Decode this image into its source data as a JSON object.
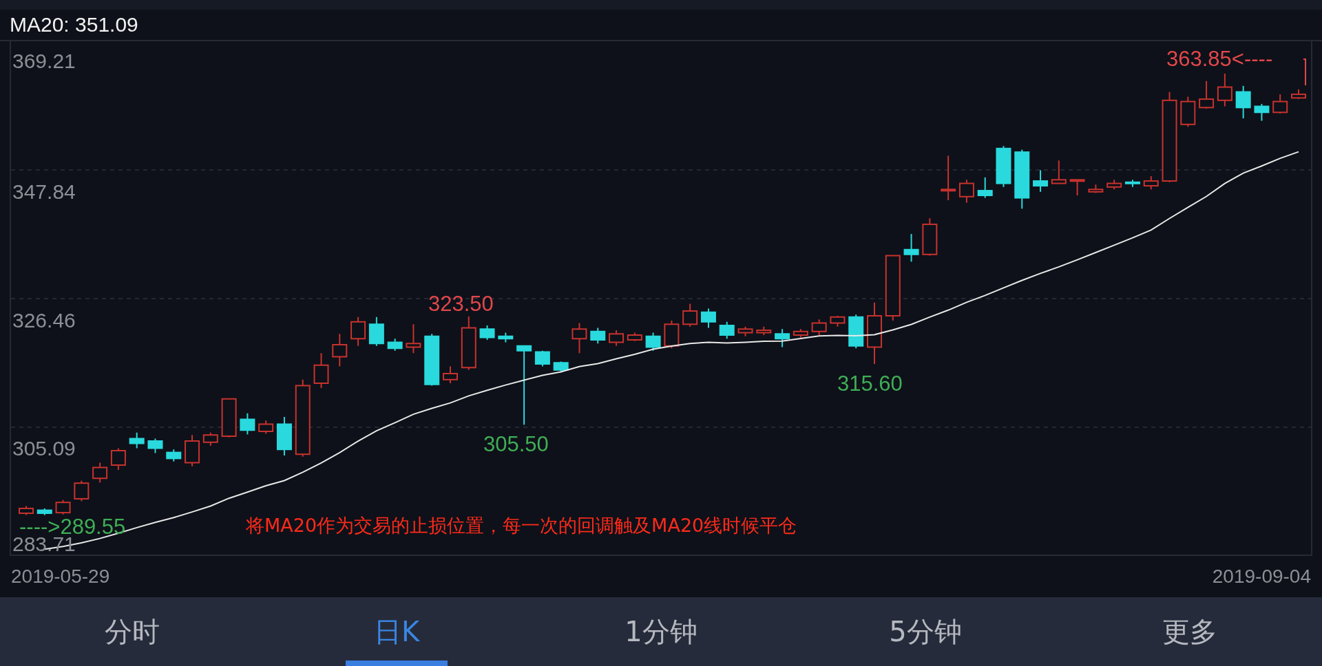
{
  "header": {
    "indicator": "MA20: 351.09"
  },
  "chart": {
    "y_labels": [
      "369.21",
      "347.84",
      "326.46",
      "305.09",
      "283.71"
    ],
    "annotations": [
      {
        "kind": "high",
        "text": "363.85<----"
      },
      {
        "kind": "high",
        "text": "323.50"
      },
      {
        "kind": "low",
        "text": "305.50"
      },
      {
        "kind": "low",
        "text": "315.60"
      },
      {
        "kind": "low",
        "text": "---->289.55"
      }
    ],
    "caption": "将MA20作为交易的止损位置，每一次的回调触及MA20线时候平仓",
    "dates": [
      "2019-05-29",
      "2019-09-04"
    ]
  },
  "tabs": [
    {
      "label": "分时",
      "selected": false
    },
    {
      "label": "日K",
      "selected": true
    },
    {
      "label": "1分钟",
      "selected": false
    },
    {
      "label": "5分钟",
      "selected": false
    },
    {
      "label": "更多",
      "selected": false
    }
  ]
}
